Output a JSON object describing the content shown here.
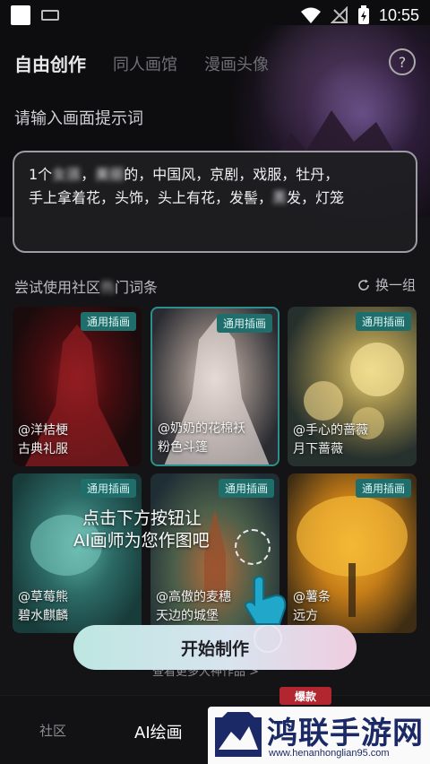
{
  "status_bar": {
    "time": "10:55"
  },
  "tabs": [
    {
      "label": "自由创作",
      "active": true
    },
    {
      "label": "同人画馆",
      "active": false
    },
    {
      "label": "漫画头像",
      "active": false
    }
  ],
  "help_icon": "?",
  "prompt": {
    "label": "请输入画面提示词",
    "line1_a": "1个",
    "line1_blur1": "女孩",
    "line1_b": "，",
    "line1_blur2": "美丽",
    "line1_c": "的，中国风，京剧，戏服，牡丹，",
    "line2_a": "手上拿着花，头饰，头上有花，发髻，",
    "line2_blur": "黑",
    "line2_b": "发，灯笼"
  },
  "suggestions": {
    "label_a": "尝试使用社区",
    "label_blur": "热",
    "label_b": "门词条",
    "refresh_label": "换一组"
  },
  "cards": [
    {
      "badge": "通用插画",
      "caption_line1": "@洋桔梗",
      "caption_line2": "古典礼服"
    },
    {
      "badge": "通用插画",
      "caption_line1": "@奶奶的花棉袄",
      "caption_line2": "粉色斗篷"
    },
    {
      "badge": "通用插画",
      "caption_line1": "@手心的蔷薇",
      "caption_line2": "月下蔷薇"
    },
    {
      "badge": "通用插画",
      "caption_line1": "@草莓熊",
      "caption_line2": "碧水麒麟"
    },
    {
      "badge": "通用插画",
      "caption_line1": "@高傲的麦穗",
      "caption_line2": "天边的城堡"
    },
    {
      "badge": "通用插画",
      "caption_line1": "@薯条",
      "caption_line2": "远方"
    }
  ],
  "guide": {
    "line1": "点击下方按钮让",
    "line2": "AI画师为您作图吧"
  },
  "start_button": "开始制作",
  "more_works": "查看更多大神作品 >",
  "hot_badge": "爆款",
  "bottom_nav": [
    {
      "label": "社区",
      "active": false
    },
    {
      "label": "AI绘画",
      "active": true
    }
  ],
  "watermark": {
    "title": "鸿联手游网",
    "url": "www.henanhonglian95.com"
  }
}
